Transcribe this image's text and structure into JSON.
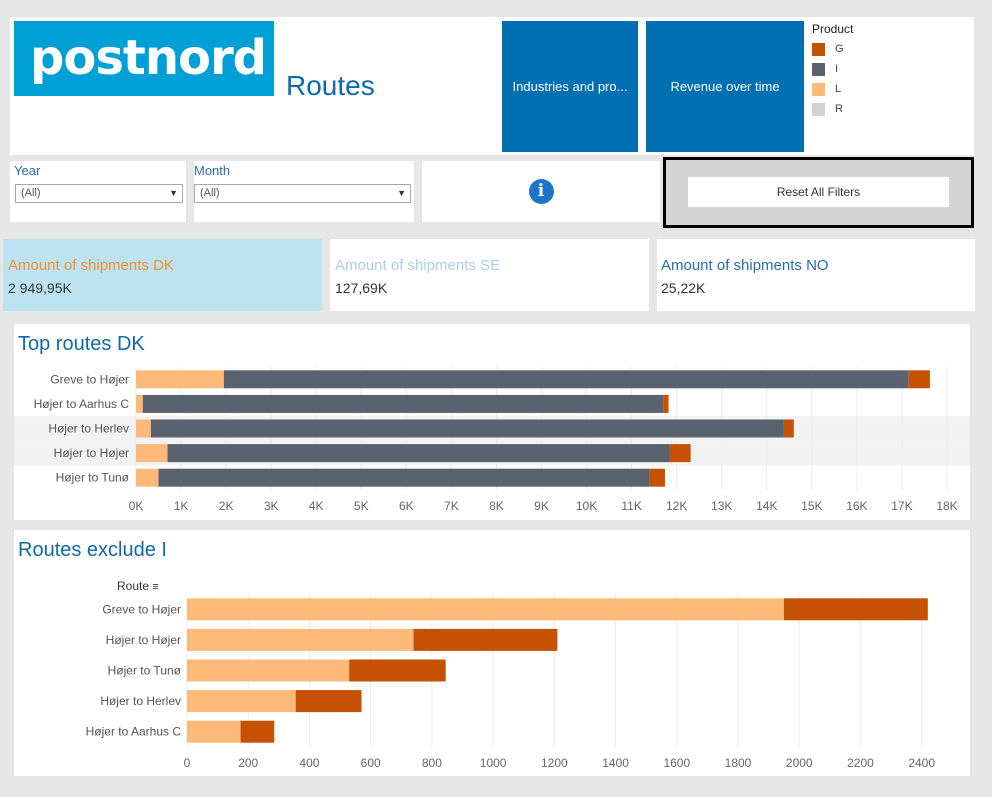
{
  "header": {
    "logo_text": "postnord",
    "title": "Routes",
    "nav_buttons": [
      {
        "label": "Industries and pro..."
      },
      {
        "label": "Revenue over time"
      }
    ]
  },
  "legend": {
    "title": "Product",
    "items": [
      {
        "label": "G",
        "color": "#c65102"
      },
      {
        "label": "I",
        "color": "#5a6270"
      },
      {
        "label": "L",
        "color": "#fdb978"
      },
      {
        "label": "R",
        "color": "#cfd3d9"
      }
    ]
  },
  "filters": {
    "year": {
      "label": "Year",
      "value": "(All)"
    },
    "month": {
      "label": "Month",
      "value": "(All)"
    },
    "info_glyph": "i",
    "reset_label": "Reset All Filters"
  },
  "kpis": [
    {
      "label": "Amount of shipments DK",
      "value": "2 949,95K",
      "label_color": "#f28e2b",
      "bg": "#bde3f2"
    },
    {
      "label": "Amount of shipments SE",
      "value": "127,69K",
      "label_color": "#a9cfe6",
      "bg": "#ffffff"
    },
    {
      "label": "Amount of shipments NO",
      "value": "25,22K",
      "label_color": "#1f6faa",
      "bg": "#ffffff"
    }
  ],
  "top_routes": {
    "title": "Top routes DK"
  },
  "routes_exclude": {
    "title": "Routes exclude I",
    "sort_header": "Route"
  },
  "chart_data": [
    {
      "type": "bar",
      "orientation": "horizontal",
      "stacked": true,
      "title": "Top routes DK",
      "categories": [
        "Greve to Højer",
        "Højer to Aarhus C",
        "Højer to Herlev",
        "Højer to Højer",
        "Højer to Tunø"
      ],
      "series": [
        {
          "name": "L",
          "color": "#fdb978",
          "values": [
            1950,
            150,
            330,
            700,
            500
          ]
        },
        {
          "name": "I",
          "color": "#5a6270",
          "values": [
            15200,
            11550,
            14050,
            11150,
            10900
          ]
        },
        {
          "name": "G",
          "color": "#c65102",
          "values": [
            470,
            120,
            220,
            460,
            340
          ]
        }
      ],
      "xlim": [
        0,
        18000
      ],
      "xticks": [
        0,
        1000,
        2000,
        3000,
        4000,
        5000,
        6000,
        7000,
        8000,
        9000,
        10000,
        11000,
        12000,
        13000,
        14000,
        15000,
        16000,
        17000,
        18000
      ],
      "xtick_labels": [
        "0K",
        "1K",
        "2K",
        "3K",
        "4K",
        "5K",
        "6K",
        "7K",
        "8K",
        "9K",
        "10K",
        "11K",
        "12K",
        "13K",
        "14K",
        "15K",
        "16K",
        "17K",
        "18K"
      ],
      "highlight_rows": [
        2,
        3
      ],
      "grid": true
    },
    {
      "type": "bar",
      "orientation": "horizontal",
      "stacked": true,
      "title": "Routes exclude I",
      "categories": [
        "Greve to Højer",
        "Højer to Højer",
        "Højer to Tunø",
        "Højer to Herlev",
        "Højer to Aarhus C"
      ],
      "series": [
        {
          "name": "L",
          "color": "#fdb978",
          "values": [
            1950,
            740,
            530,
            355,
            175
          ]
        },
        {
          "name": "G",
          "color": "#c65102",
          "values": [
            470,
            470,
            315,
            215,
            110
          ]
        }
      ],
      "xlim": [
        0,
        2450
      ],
      "xticks": [
        0,
        200,
        400,
        600,
        800,
        1000,
        1200,
        1400,
        1600,
        1800,
        2000,
        2200,
        2400
      ],
      "xtick_labels": [
        "0",
        "200",
        "400",
        "600",
        "800",
        "1000",
        "1200",
        "1400",
        "1600",
        "1800",
        "2000",
        "2200",
        "2400"
      ],
      "grid": true
    }
  ]
}
